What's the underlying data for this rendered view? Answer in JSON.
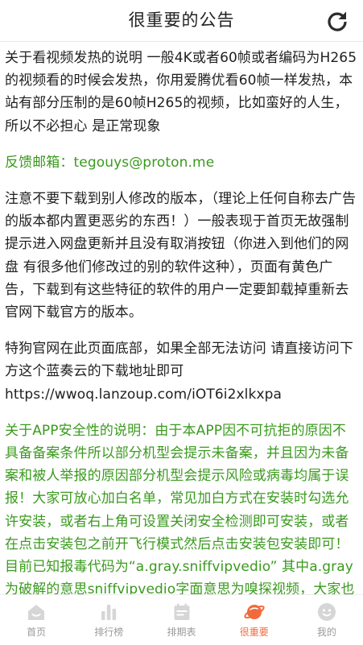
{
  "header": {
    "title": "很重要的公告",
    "refresh_icon": "refresh-icon"
  },
  "notice": {
    "paragraphs": [
      {
        "color": "black",
        "text": "关于看视频发热的说明 一般4K或者60帧或者编码为H265的视频看的时候会发热，你用爱腾优看60帧一样发热，本站有部分压制的是60帧H265的视频，比如蛮好的人生，所以不必担心 是正常现象"
      },
      {
        "color": "green",
        "text": "反馈邮箱：tegouys@proton.me"
      },
      {
        "color": "black",
        "text": "注意不要下载到别人修改的版本，（理论上任何自称去广告的版本都内置更恶劣的东西！）一般表现于首页无故强制提示进入网盘更新并且没有取消按钮（你进入到他们的网盘 有很多他们修改过的别的软件这种），页面有黄色广告，下载到有这些特征的软件的用户一定要卸载掉重新去官网下载官方的版本。"
      },
      {
        "color": "black",
        "text": "特狗官网在此页面底部，如果全部无法访问 请直接访问下方这个蓝奏云的下载地址即可\nhttps://wwoq.lanzoup.com/iOT6i2xlkxpa"
      },
      {
        "color": "green",
        "text": "关于APP安全性的说明：由于本APP因不可抗拒的原因不具备备案条件所以部分机型会提示未备案，并且因为未备案和被人举报的原因部分机型会提示风险或病毒均属于误报！大家可放心加白名单，常见加白方式在安装时勾选允许安装，或者右上角可设置关闭安全检测即可安装，或者在点击安装包之前开飞行模式然后点击安装包安装即可！目前已知报毒代码为“a.gray.sniffvipvedio” 其中a.gray为破解的意思sniffvipvedio字面意思为嗅探视频，大家也都知道本"
      }
    ]
  },
  "colors": {
    "text": "#1f1f1f",
    "green": "#3a9a1e",
    "tab_inactive": "#9a9a9a",
    "tab_active": "#f26a3c"
  },
  "tabbar": {
    "tabs": [
      {
        "label": "首页",
        "icon": "home-icon",
        "active": false
      },
      {
        "label": "排行榜",
        "icon": "bar-chart-icon",
        "active": false
      },
      {
        "label": "排期表",
        "icon": "schedule-icon",
        "active": false
      },
      {
        "label": "很重要",
        "icon": "planet-icon",
        "active": true
      },
      {
        "label": "我的",
        "icon": "profile-face-icon",
        "active": false
      }
    ]
  }
}
